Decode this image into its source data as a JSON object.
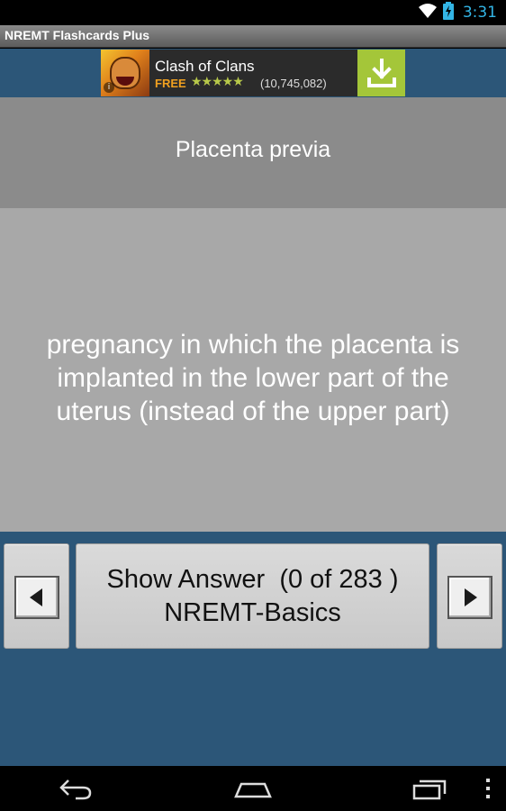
{
  "status_bar": {
    "time": "3:31",
    "icons": [
      "wifi-icon",
      "battery-charging-icon"
    ]
  },
  "app": {
    "title": "NREMT Flashcards Plus"
  },
  "ad": {
    "title": "Clash of Clans",
    "price": "FREE",
    "rating_stars": "★★★★★",
    "review_count": "(10,745,082)",
    "info_glyph": "i",
    "icon": "download-icon",
    "colors": {
      "band": "#2c5678",
      "download": "#a4c639",
      "free": "#f0a020"
    }
  },
  "card": {
    "question": "Placenta previa",
    "answer": "pregnancy in which the placenta is implanted in the lower part of the uterus (instead of the upper part)"
  },
  "controls": {
    "prev_icon": "left-arrow-icon",
    "next_icon": "right-arrow-icon",
    "center_line1": "Show Answer  (0 of 283 )",
    "center_line2": "NREMT-Basics"
  },
  "system_nav": {
    "icons": [
      "back-icon",
      "home-icon",
      "recents-icon",
      "menu-icon"
    ]
  }
}
